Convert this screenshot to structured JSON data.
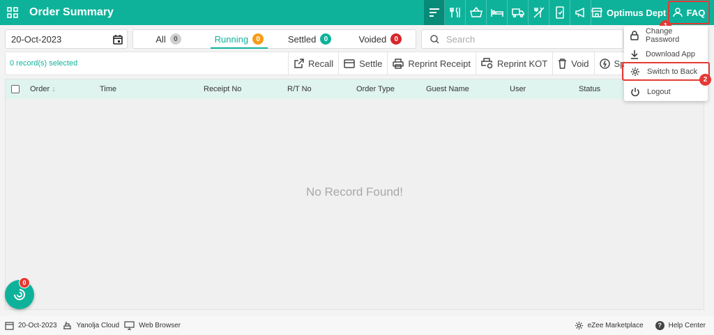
{
  "header": {
    "title": "Order Summary",
    "department": "Optimus Dept",
    "faq_label": "FAQ",
    "icons": [
      "filter-icon",
      "restaurant-icon",
      "basket-icon",
      "hotel-bed-icon",
      "delivery-truck-icon",
      "no-food-icon",
      "mobile-order-icon",
      "announcement-icon"
    ]
  },
  "filters": {
    "date": "20-Oct-2023",
    "tabs": [
      {
        "label": "All",
        "count": "0",
        "color": "#cfcfcf",
        "text_color": "#555555"
      },
      {
        "label": "Running",
        "count": "0",
        "color": "#f59c1a",
        "text_color": "#ffffff"
      },
      {
        "label": "Settled",
        "count": "0",
        "color": "#0eb29a",
        "text_color": "#ffffff"
      },
      {
        "label": "Voided",
        "count": "0",
        "color": "#d7262b",
        "text_color": "#ffffff"
      }
    ],
    "active_tab": "Running",
    "search_placeholder": "Search"
  },
  "actions": {
    "selected_text": "0 record(s) selected",
    "buttons": [
      "Recall",
      "Settle",
      "Reprint Receipt",
      "Reprint KOT",
      "Void",
      "Split"
    ]
  },
  "table": {
    "columns": [
      "Order",
      "Time",
      "Receipt No",
      "R/T No",
      "Order Type",
      "Guest Name",
      "User",
      "Status"
    ],
    "empty_text": "No Record Found!"
  },
  "menu": {
    "items": [
      "Change Password",
      "Download App",
      "Switch to Back",
      "Logout"
    ],
    "highlighted": "Switch to Back"
  },
  "annotations": [
    "1",
    "2"
  ],
  "fab_badge": "0",
  "footer": {
    "date": "20-Oct-2023",
    "cloud": "Yanolja Cloud",
    "browser": "Web Browser",
    "marketplace": "eZee Marketplace",
    "help": "Help Center"
  },
  "colors": {
    "accent": "#0eb29a",
    "highlight_border": "#e53935",
    "table_header": "#dff3ef"
  }
}
